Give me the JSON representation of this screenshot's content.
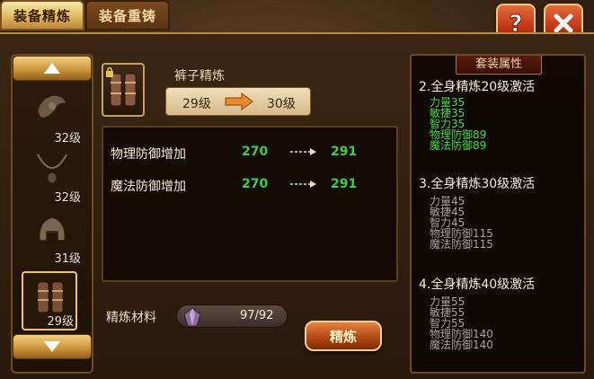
{
  "tabs": [
    {
      "label": "装备精炼",
      "active": true
    },
    {
      "label": "装备重铸",
      "active": false
    }
  ],
  "top_buttons": {
    "help_symbol": "?",
    "close_symbol": "×"
  },
  "equipment_list": [
    {
      "level": "32级",
      "icon": "shoulder-armor-icon"
    },
    {
      "level": "32级",
      "icon": "necklace-icon"
    },
    {
      "level": "31级",
      "icon": "helmet-icon"
    },
    {
      "level": "29级",
      "icon": "leg-armor-icon",
      "selected": true
    }
  ],
  "selected_item": {
    "name": "裤子精炼",
    "from_level": "29级",
    "to_level": "30级"
  },
  "stats": [
    {
      "name": "物理防御增加",
      "old": "270",
      "new": "291"
    },
    {
      "name": "魔法防御增加",
      "old": "270",
      "new": "291"
    }
  ],
  "material": {
    "label": "精炼材料",
    "count": "97/92"
  },
  "refine_button": "精炼",
  "set_attributes": {
    "title": "套装属性",
    "tiers": [
      {
        "header": "2.全身精炼20级激活",
        "active": true,
        "lines": [
          "力量35",
          "敏捷35",
          "智力35",
          "物理防御89",
          "魔法防御89"
        ]
      },
      {
        "header": "3.全身精炼30级激活",
        "active": false,
        "lines": [
          "力量45",
          "敏捷45",
          "智力45",
          "物理防御115",
          "魔法防御115"
        ]
      },
      {
        "header": "4.全身精炼40级激活",
        "active": false,
        "lines": [
          "力量55",
          "敏捷55",
          "智力55",
          "物理防御140",
          "魔法防御140"
        ]
      }
    ]
  },
  "colors": {
    "active_green": "#3fdc3f",
    "inactive_gray": "#a8a29a",
    "gold": "#e0b960"
  }
}
